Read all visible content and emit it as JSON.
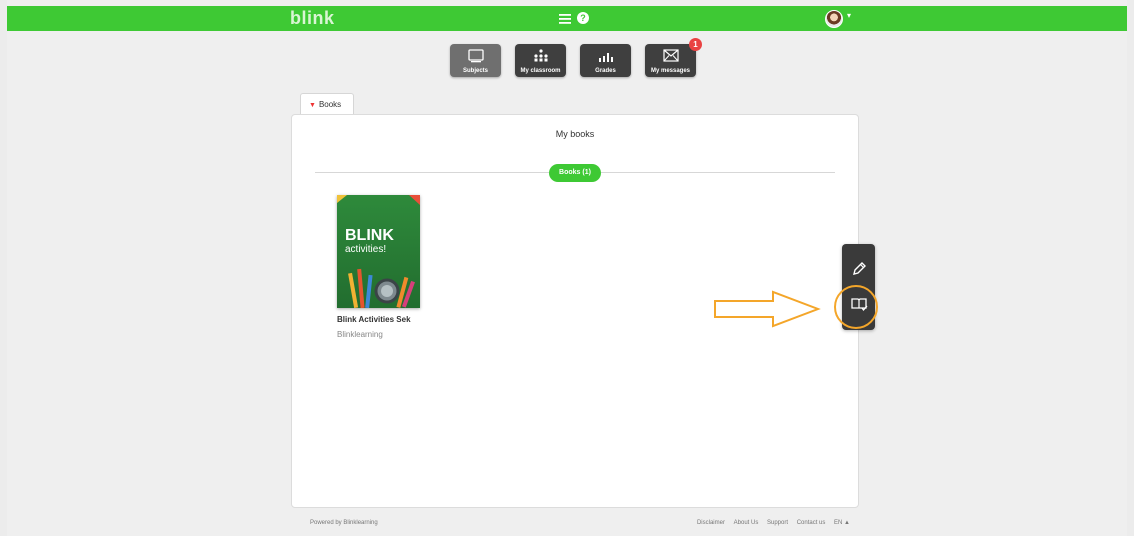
{
  "app": {
    "logo": "blink",
    "help_glyph": "?",
    "brand_color": "#3ec934"
  },
  "nav": [
    {
      "label": "Subjects",
      "icon": "subjects-icon",
      "active": true
    },
    {
      "label": "My classroom",
      "icon": "classroom-icon",
      "active": false
    },
    {
      "label": "Grades",
      "icon": "grades-icon",
      "active": false
    },
    {
      "label": "My messages",
      "icon": "messages-icon",
      "active": false,
      "badge": "1"
    }
  ],
  "tab": {
    "label": "Books"
  },
  "panel": {
    "title": "My books",
    "filter_pill": "Books (1)"
  },
  "book": {
    "cover_title": "BLINK",
    "cover_subtitle": "activities!",
    "title": "Blink Activities Sek",
    "publisher": "Blinklearning"
  },
  "footer": {
    "powered": "Powered by Blinklearning",
    "links": [
      "Disclaimer",
      "About Us",
      "Support",
      "Contact us",
      "EN ▲"
    ]
  },
  "annotation": {
    "color": "#f4a62a"
  }
}
